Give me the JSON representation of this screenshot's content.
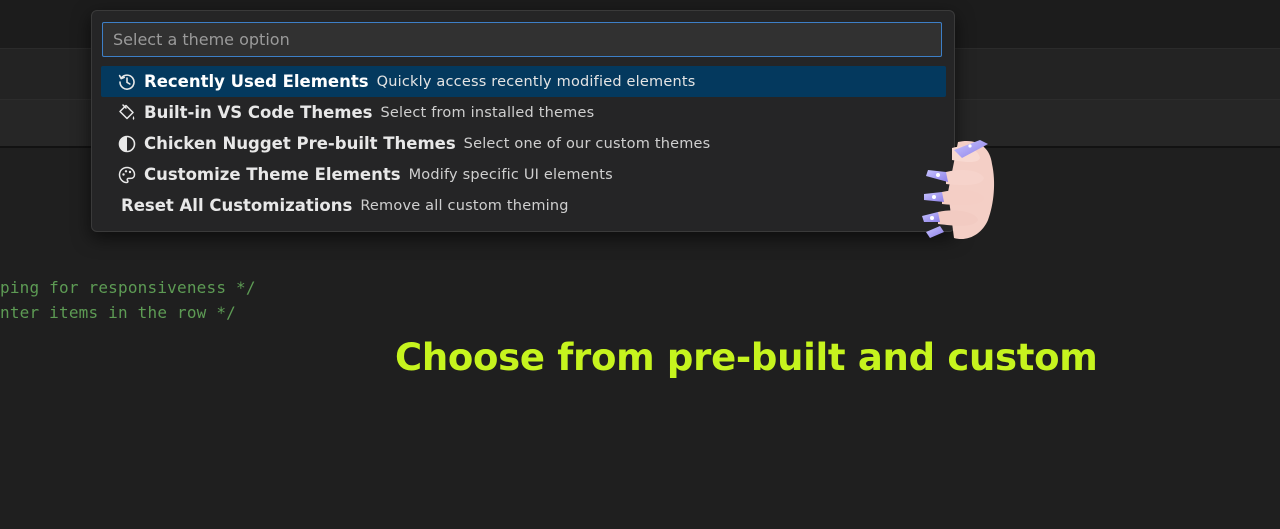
{
  "search": {
    "placeholder": "Select a theme option",
    "value": ""
  },
  "options": [
    {
      "label": "Recently Used Elements",
      "description": "Quickly access recently modified elements",
      "icon": "history-icon",
      "selected": true
    },
    {
      "label": "Built-in VS Code Themes",
      "description": "Select from installed themes",
      "icon": "paint-bucket-icon",
      "selected": false
    },
    {
      "label": "Chicken Nugget Pre-built Themes",
      "description": "Select one of our custom themes",
      "icon": "contrast-icon",
      "selected": false
    },
    {
      "label": "Customize Theme Elements",
      "description": "Modify specific UI elements",
      "icon": "palette-icon",
      "selected": false
    },
    {
      "label": "Reset All Customizations",
      "description": "Remove all custom theming",
      "icon": "",
      "selected": false
    }
  ],
  "editor": {
    "code_lines": [
      "ping for responsiveness */",
      "nter items in the row */"
    ]
  },
  "caption": {
    "text": "Choose from pre-built and custom",
    "color": "#c6f41e"
  },
  "colors": {
    "accent_border": "#3d7fc7",
    "selection": "#04395e",
    "comment": "#5d9b54"
  }
}
